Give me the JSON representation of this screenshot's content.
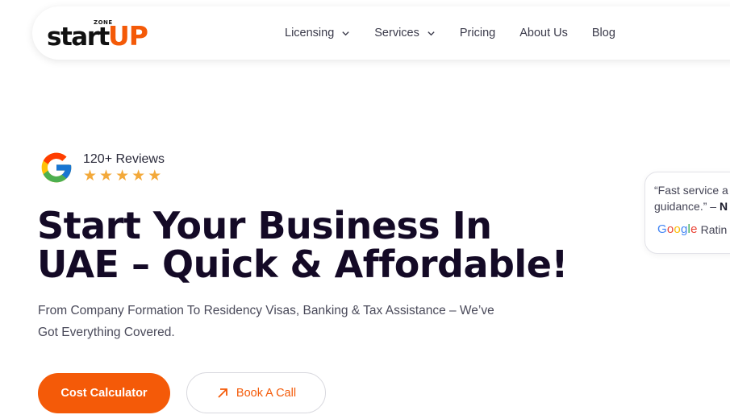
{
  "brand": {
    "zone_text": "ZONE",
    "start_text": "start",
    "up_text": "UP",
    "accent_color": "#f45a08"
  },
  "nav": {
    "items": [
      {
        "label": "Licensing",
        "has_dropdown": true
      },
      {
        "label": "Services",
        "has_dropdown": true
      },
      {
        "label": "Pricing",
        "has_dropdown": false
      },
      {
        "label": "About Us",
        "has_dropdown": false
      },
      {
        "label": "Blog",
        "has_dropdown": false
      }
    ]
  },
  "reviews": {
    "count_label": "120+ Reviews",
    "stars": 5,
    "star_color": "#f3a93a"
  },
  "hero": {
    "title_line1": "Start Your Business In",
    "title_line2": "UAE – Quick & Affordable!",
    "subtitle": "From Company Formation To Residency Visas, Banking & Tax Assistance – We’ve Got Everything Covered."
  },
  "buttons": {
    "primary_label": "Cost Calculator",
    "secondary_label": "Book A Call"
  },
  "review_card": {
    "quote_line1": "“Fast service a",
    "quote_line2": "guidance.” – ",
    "author_initial": "N",
    "google_word": "Google",
    "rating_word": "Ratin"
  }
}
